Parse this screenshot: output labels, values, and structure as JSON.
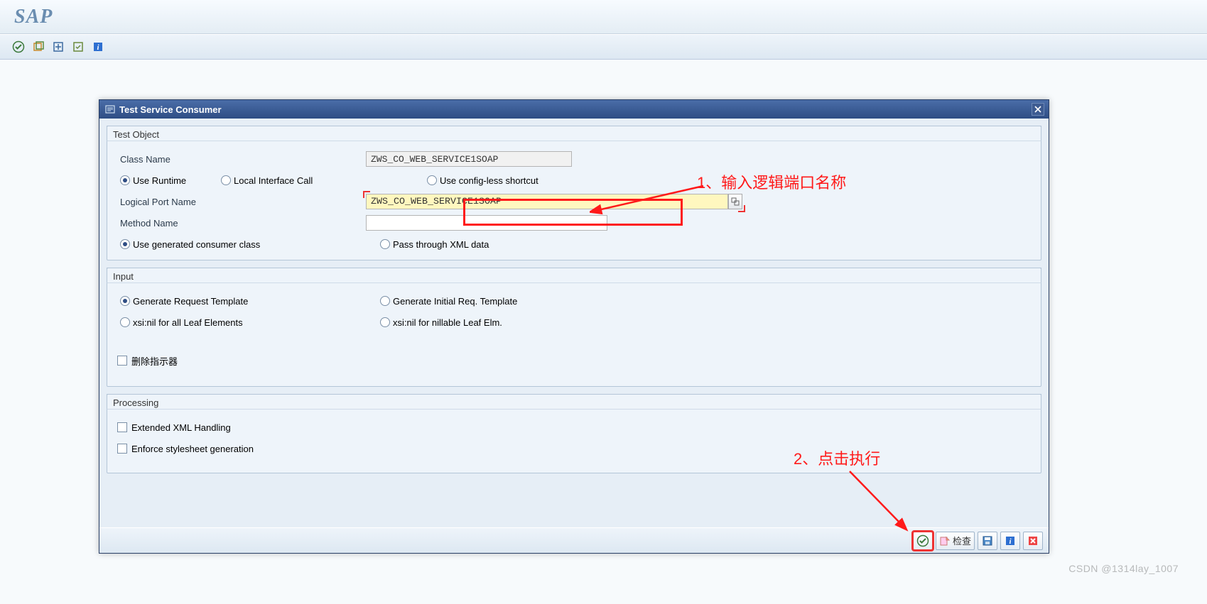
{
  "header": {
    "logo": "SAP"
  },
  "dialog": {
    "title": "Test Service Consumer",
    "groups": {
      "test_object": {
        "title": "Test Object",
        "class_name_label": "Class Name",
        "class_name_value": "ZWS_CO_WEB_SERVICE1SOAP",
        "radio_use_runtime": "Use Runtime",
        "radio_local_interface": "Local Interface Call",
        "radio_config_less": "Use config-less shortcut",
        "logical_port_label": "Logical Port Name",
        "logical_port_value": "ZWS_CO_WEB_SERVICE1SOAP",
        "method_name_label": "Method Name",
        "method_name_value": "",
        "radio_use_generated": "Use generated consumer class",
        "radio_pass_through": "Pass through XML data"
      },
      "input": {
        "title": "Input",
        "radio_gen_request": "Generate Request Template",
        "radio_gen_initial": "Generate Initial Req. Template",
        "radio_xsinil_all": "xsi:nil for all Leaf Elements",
        "radio_xsinil_nillable": "xsi:nil for nillable Leaf Elm.",
        "cb_delete_indicator": "删除指示器"
      },
      "processing": {
        "title": "Processing",
        "cb_ext_xml": "Extended XML Handling",
        "cb_enforce_style": "Enforce stylesheet generation"
      }
    },
    "footer": {
      "check_label": "检查"
    }
  },
  "annotations": {
    "note1": "1、输入逻辑端口名称",
    "note2": "2、点击执行"
  },
  "watermark": "CSDN @1314lay_1007"
}
